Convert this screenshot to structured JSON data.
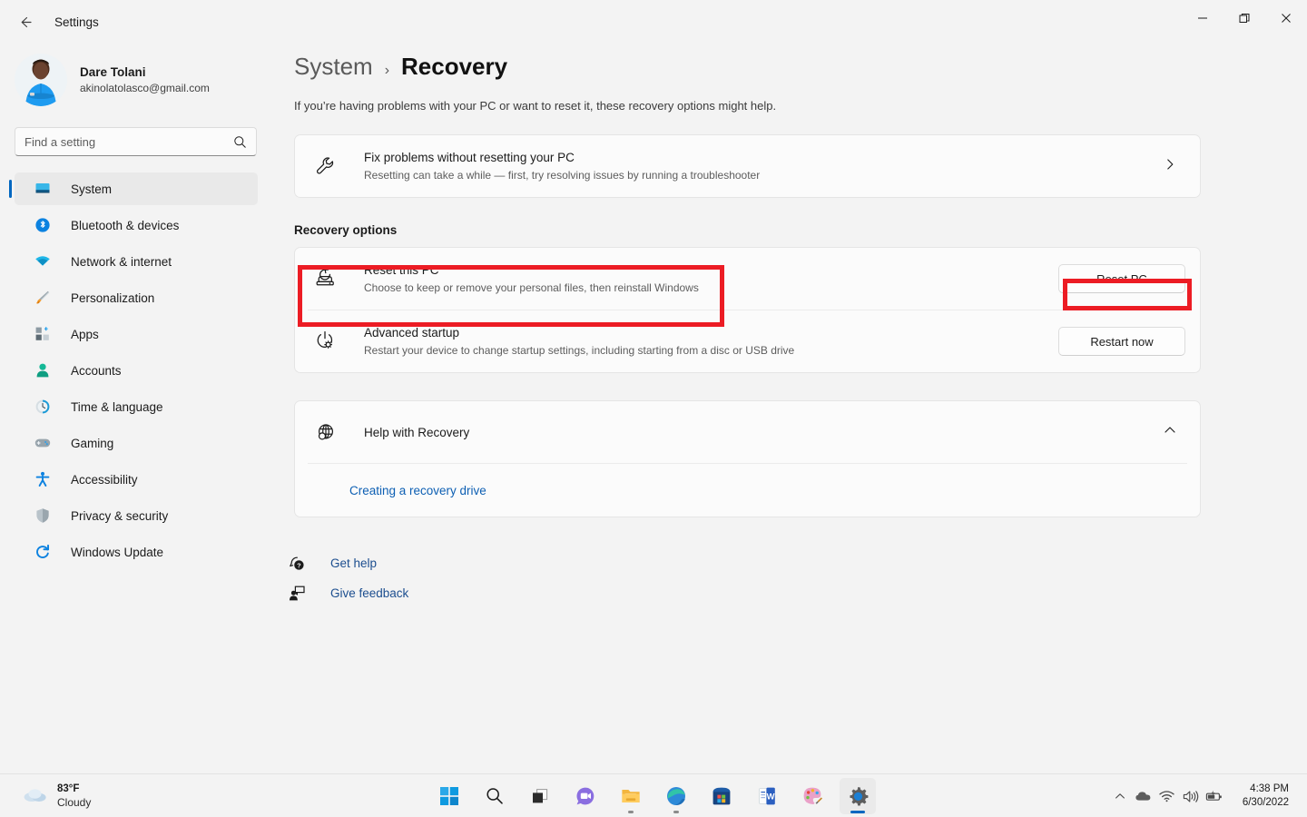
{
  "window": {
    "title": "Settings",
    "back_icon": "arrow-left-icon",
    "controls": {
      "minimize": "minimize-icon",
      "maximize": "restore-icon",
      "close": "close-icon"
    }
  },
  "sidebar": {
    "profile": {
      "name": "Dare Tolani",
      "email": "akinolatolasco@gmail.com"
    },
    "search": {
      "placeholder": "Find a setting",
      "value": "",
      "icon": "search-icon"
    },
    "items": [
      {
        "label": "System",
        "icon": "system-icon",
        "selected": true
      },
      {
        "label": "Bluetooth & devices",
        "icon": "bluetooth-icon",
        "selected": false
      },
      {
        "label": "Network & internet",
        "icon": "wifi-icon",
        "selected": false
      },
      {
        "label": "Personalization",
        "icon": "paintbrush-icon",
        "selected": false
      },
      {
        "label": "Apps",
        "icon": "apps-icon",
        "selected": false
      },
      {
        "label": "Accounts",
        "icon": "person-icon",
        "selected": false
      },
      {
        "label": "Time & language",
        "icon": "clock-icon",
        "selected": false
      },
      {
        "label": "Gaming",
        "icon": "gamepad-icon",
        "selected": false
      },
      {
        "label": "Accessibility",
        "icon": "accessibility-icon",
        "selected": false
      },
      {
        "label": "Privacy & security",
        "icon": "shield-icon",
        "selected": false
      },
      {
        "label": "Windows Update",
        "icon": "update-icon",
        "selected": false
      }
    ]
  },
  "main": {
    "breadcrumb": {
      "parent": "System",
      "separator": "›",
      "current": "Recovery"
    },
    "description": "If you’re having problems with your PC or want to reset it, these recovery options might help.",
    "troubleshoot_card": {
      "title": "Fix problems without resetting your PC",
      "subtitle": "Resetting can take a while — first, try resolving issues by running a troubleshooter",
      "icon": "wrench-icon",
      "chevron": "chevron-right-icon"
    },
    "section_header": "Recovery options",
    "options": [
      {
        "title": "Reset this PC",
        "subtitle": "Choose to keep or remove your personal files, then reinstall Windows",
        "icon": "reset-pc-icon",
        "button": "Reset PC",
        "highlighted": true
      },
      {
        "title": "Advanced startup",
        "subtitle": "Restart your device to change startup settings, including starting from a disc or USB drive",
        "icon": "advanced-startup-icon",
        "button": "Restart now",
        "highlighted": false
      }
    ],
    "help_card": {
      "title": "Help with Recovery",
      "icon": "globe-icon",
      "chevron": "chevron-up-icon",
      "links": [
        "Creating a recovery drive"
      ]
    },
    "footer_links": [
      {
        "label": "Get help",
        "icon": "help-icon"
      },
      {
        "label": "Give feedback",
        "icon": "feedback-icon"
      }
    ]
  },
  "taskbar": {
    "weather": {
      "temperature": "83°F",
      "condition": "Cloudy",
      "icon": "cloud-icon"
    },
    "apps": [
      {
        "name": "start-button",
        "icon": "windows-logo-icon"
      },
      {
        "name": "search-button",
        "icon": "search-icon"
      },
      {
        "name": "task-view-button",
        "icon": "task-view-icon"
      },
      {
        "name": "chat-button",
        "icon": "chat-icon"
      },
      {
        "name": "file-explorer-button",
        "icon": "folder-icon"
      },
      {
        "name": "edge-button",
        "icon": "edge-icon"
      },
      {
        "name": "microsoft-store-button",
        "icon": "store-icon"
      },
      {
        "name": "word-button",
        "icon": "word-icon"
      },
      {
        "name": "paint-button",
        "icon": "paint-icon"
      },
      {
        "name": "settings-button",
        "icon": "gear-icon"
      }
    ],
    "tray": [
      {
        "name": "show-hidden-icons",
        "icon": "chevron-up-icon"
      },
      {
        "name": "onedrive-icon",
        "icon": "cloud-icon"
      },
      {
        "name": "network-icon",
        "icon": "wifi-icon"
      },
      {
        "name": "volume-icon",
        "icon": "speaker-icon"
      },
      {
        "name": "battery-icon",
        "icon": "battery-icon"
      }
    ],
    "clock": {
      "time": "4:38 PM",
      "date": "6/30/2022"
    }
  },
  "colors": {
    "accent": "#0067c0",
    "annotation_red": "#ec1c24",
    "link_blue": "#0d5fb3",
    "window_bg": "#f3f3f3",
    "card_bg": "#fbfbfb"
  }
}
